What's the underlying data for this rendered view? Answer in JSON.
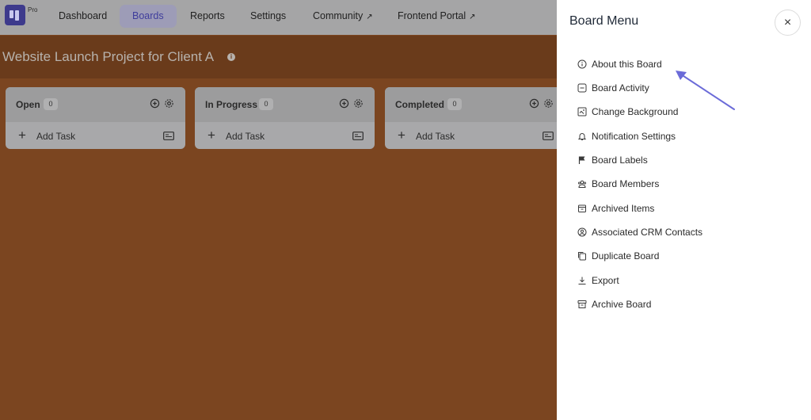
{
  "nav": {
    "pro_badge": "Pro",
    "items": [
      {
        "label": "Dashboard",
        "external": ""
      },
      {
        "label": "Boards",
        "external": ""
      },
      {
        "label": "Reports",
        "external": ""
      },
      {
        "label": "Settings",
        "external": ""
      },
      {
        "label": "Community",
        "external": "↗"
      },
      {
        "label": "Frontend Portal",
        "external": "↗"
      }
    ],
    "active_item": "Boards"
  },
  "board": {
    "title": "Website Launch Project for Client A",
    "info_glyph": "i",
    "columns": [
      {
        "name": "Open",
        "count": "0",
        "add_label": "Add Task"
      },
      {
        "name": "In Progress",
        "count": "0",
        "add_label": "Add Task"
      },
      {
        "name": "Completed",
        "count": "0",
        "add_label": "Add Task"
      }
    ]
  },
  "panel": {
    "title": "Board Menu",
    "close_glyph": "×",
    "items": [
      {
        "label": "About this Board",
        "icon": "info-icon"
      },
      {
        "label": "Board Activity",
        "icon": "activity-icon"
      },
      {
        "label": "Change Background",
        "icon": "image-icon"
      },
      {
        "label": "Notification Settings",
        "icon": "bell-icon"
      },
      {
        "label": "Board Labels",
        "icon": "flag-icon"
      },
      {
        "label": "Board Members",
        "icon": "members-icon"
      },
      {
        "label": "Archived Items",
        "icon": "archive-box-icon"
      },
      {
        "label": "Associated CRM Contacts",
        "icon": "user-circle-icon"
      },
      {
        "label": "Duplicate Board",
        "icon": "copy-icon"
      },
      {
        "label": "Export",
        "icon": "download-icon"
      },
      {
        "label": "Archive Board",
        "icon": "archive-icon"
      }
    ]
  },
  "colors": {
    "board_background": "#7b4520",
    "nav_overlay": "#a5a5a6",
    "active_nav": "#3f3d9c",
    "arrow": "#6b6bd8"
  }
}
